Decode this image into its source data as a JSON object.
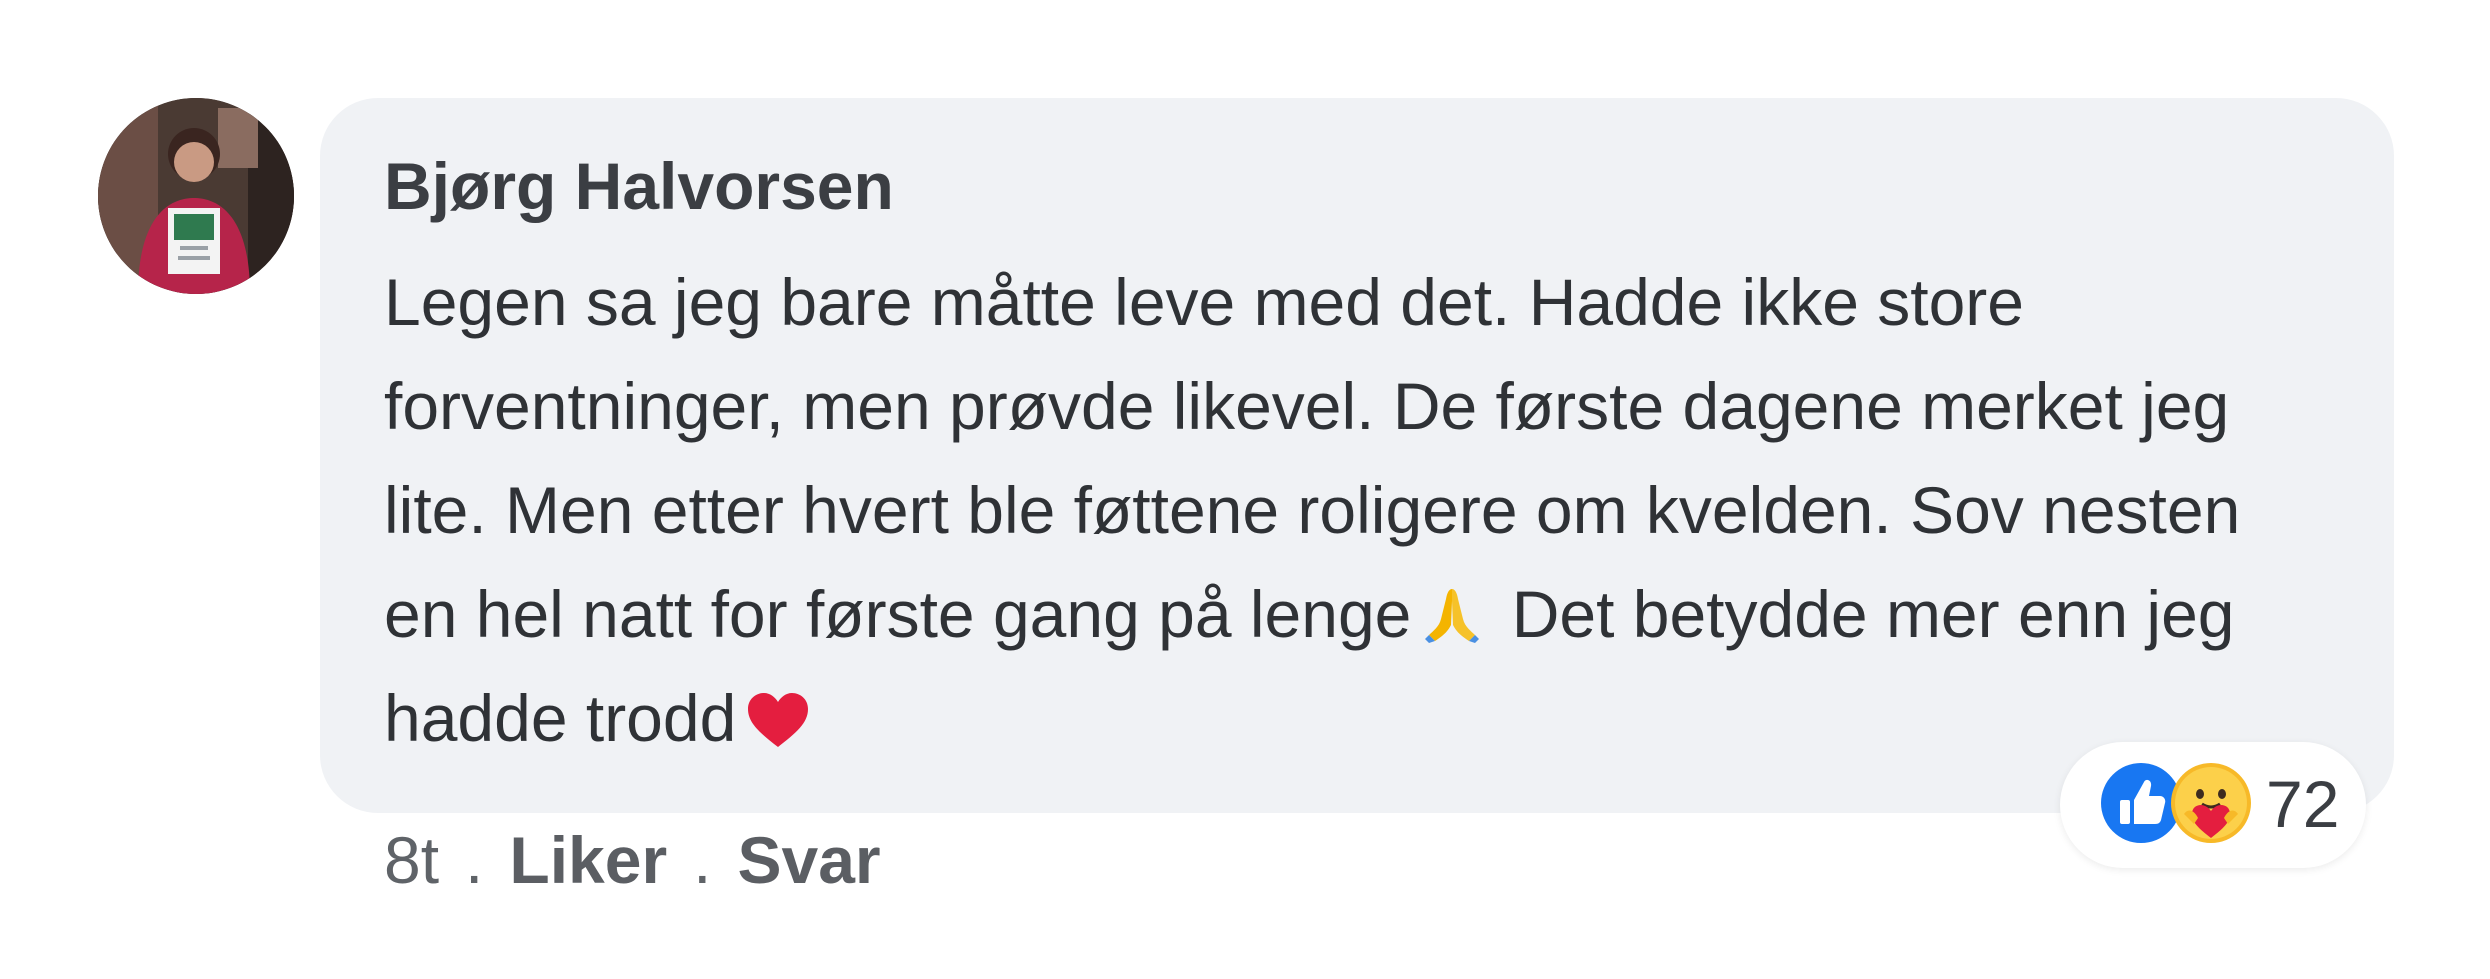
{
  "comment": {
    "author": "Bjørg Halvorsen",
    "lines": [
      "Legen sa jeg bare måtte leve med det. Hadde ikke store",
      "forventninger, men prøvde likevel. De første dagene merket jeg",
      "lite. Men etter hvert ble føttene roligere om kvelden. Sov nesten",
      "en hel natt for første gang på lenge",
      "Det betydde mer enn jeg",
      "hadde trodd"
    ],
    "emojis": {
      "inline_1": "folded-hands",
      "inline_2": "red-heart"
    }
  },
  "meta": {
    "time": "8t",
    "sep": ".",
    "like_label": "Liker",
    "reply_label": "Svar"
  },
  "reactions": {
    "types": [
      "like",
      "care"
    ],
    "count": "72"
  },
  "colors": {
    "bubble": "#f0f2f5",
    "like_blue": "#1877f2",
    "heart_red": "#e41e3f",
    "text": "#2f3236"
  }
}
